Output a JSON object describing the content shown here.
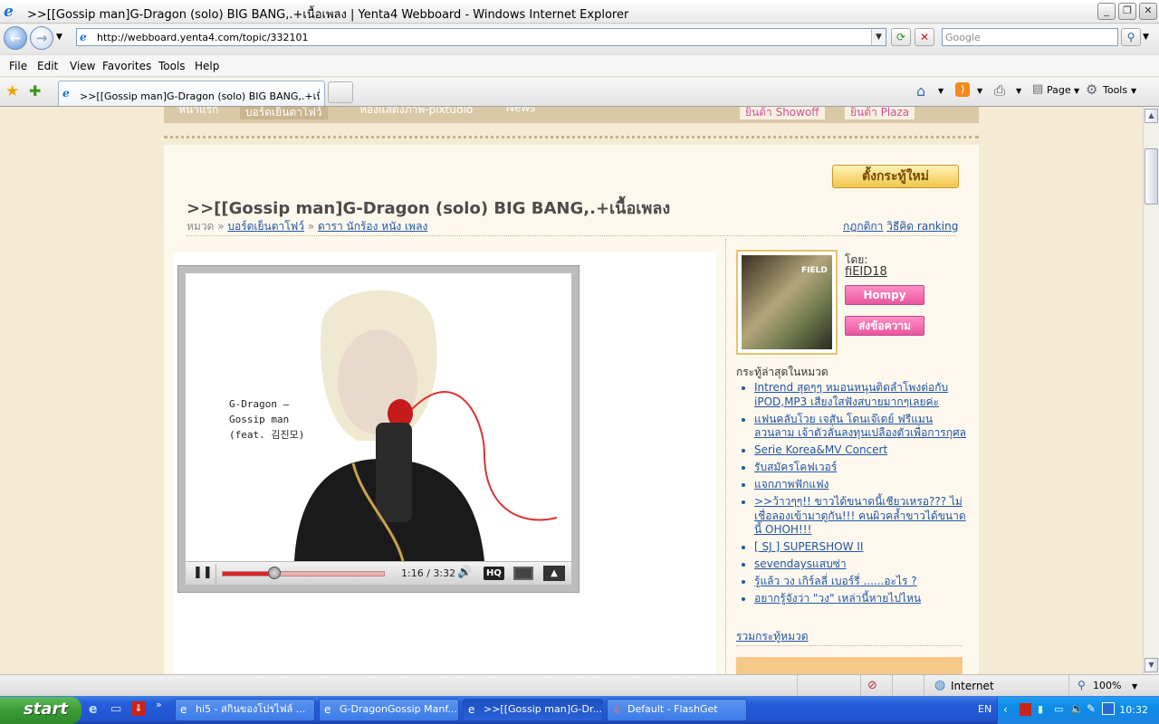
{
  "window": {
    "title": ">>[[Gossip man]G-Dragon (solo) BIG BANG,.+เนื้อเพลง | Yenta4 Webboard - Windows Internet Explorer"
  },
  "address": {
    "url": "http://webboard.yenta4.com/topic/332101",
    "search_placeholder": "Google"
  },
  "menu": [
    "File",
    "Edit",
    "View",
    "Favorites",
    "Tools",
    "Help"
  ],
  "tab": {
    "label": ">>[[Gossip man]G-Dragon (solo) BIG BANG,.+เนื้อเพ..."
  },
  "command_bar": {
    "page": "Page",
    "tools": "Tools"
  },
  "site_nav": {
    "item1": "หน้าแรก",
    "item2": "บอร์ดเย็นตาโฟว์",
    "item3": "ห้องแสดงภาพ-pixtudio",
    "item4": "News",
    "item5": "ยินต้า Showoff",
    "item6": "ยินต้า Plaza"
  },
  "topic": {
    "new_topic_button": "ตั้งกระทู้ใหม่",
    "title": ">>[[Gossip man]G-Dragon (solo) BIG BANG,.+เนื้อเพลง",
    "crumb_label": "หมวด",
    "sep": "»",
    "crumb1": "บอร์ดเย็นตาโฟว์",
    "crumb2": "ดารา นักร้อง หนัง เพลง",
    "rules": "กฎกติกา",
    "ranking": "วิธีคิด ranking"
  },
  "video": {
    "overlay_line1": "G-Dragon –",
    "overlay_line2": "Gossip man",
    "overlay_line3": "(feat. 김진모)",
    "time": "1:16 / 3:32",
    "hq": "HQ",
    "progress": 0.32,
    "buffered": 1.0
  },
  "author": {
    "by_label": "โดย:",
    "name": "fiEID18",
    "hompy_button": "Hompy",
    "message_button": "ส่งข้อความ",
    "avatar_caption": "FIELD"
  },
  "latest": {
    "heading": "กระทู้ล่าสุดในหมวด",
    "items": [
      "Intrend สุดๆๆ หมอนหนุนติดลำโพงต่อกับ iPOD,MP3 เสียงใสฟังสบายมากๆเลยค่ะ",
      "แฟนคลับโวย เจสัน โดนเจ๊เดย์ ฟรีแมน ลวนลาม เจ้าตัวลั่นลงทุนเปลืองตัวเพื่อการกุศล",
      "Serie Korea&MV Concert",
      "รับสมัครโคฟเวอร์",
      "แจกภาพฟักแฟง",
      ">>ว้าวๆๆ!! ขาวได้ขนาดนี้เชียวเหรอ??? ไม่เชื่อลองเข้ามาดูกัน!!! คนผิวคล้ำขาวได้ขนาดนี้ OHOH!!!",
      "[ SJ ] SUPERSHOW II",
      "sevendaysแสบซ่า",
      "รู้แล้ว วง เกิร์ลลี่ เบอร์รี่ ......อะไร ?",
      "อยากรู้จังว่า \"วง\" เหล่านี้หายไปไหน"
    ],
    "all_link": "รวมกระทู้หมวด"
  },
  "status": {
    "zone": "Internet",
    "zoom": "100%"
  },
  "taskbar": {
    "start": "start",
    "btn1": "hi5 - สกินของโปรไฟล์ ...",
    "btn2": "G-DragonGossip Manf...",
    "btn3": ">>[[Gossip man]G-Dr...",
    "btn4": "Default - FlashGet",
    "lang": "EN",
    "clock": "10:32"
  },
  "colors": {
    "page_bg": "#f5ead4",
    "link": "#2255a0",
    "accent_pink": "#e8569f",
    "progress_red": "#d8272a"
  }
}
